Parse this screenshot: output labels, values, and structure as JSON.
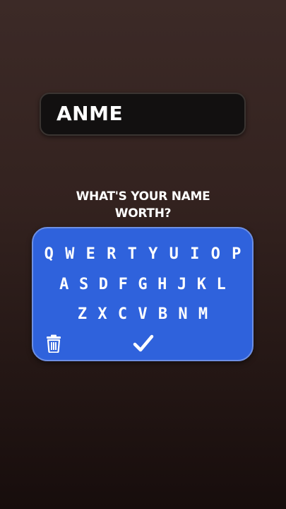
{
  "name_display": {
    "value": "ANME"
  },
  "prompt": {
    "line1": "WHAT'S YOUR NAME",
    "line2": "WORTH?"
  },
  "keyboard": {
    "row1": [
      "Q",
      "W",
      "E",
      "R",
      "T",
      "Y",
      "U",
      "I",
      "O",
      "P"
    ],
    "row2": [
      "A",
      "S",
      "D",
      "F",
      "G",
      "H",
      "J",
      "K",
      "L"
    ],
    "row3": [
      "Z",
      "X",
      "C",
      "V",
      "B",
      "N",
      "M"
    ],
    "delete_icon": "trash-icon",
    "confirm_icon": "checkmark-icon"
  },
  "colors": {
    "background": "#33221f",
    "name_bar": "#121010",
    "keyboard": "#2f62dc",
    "text": "#ffffff"
  }
}
